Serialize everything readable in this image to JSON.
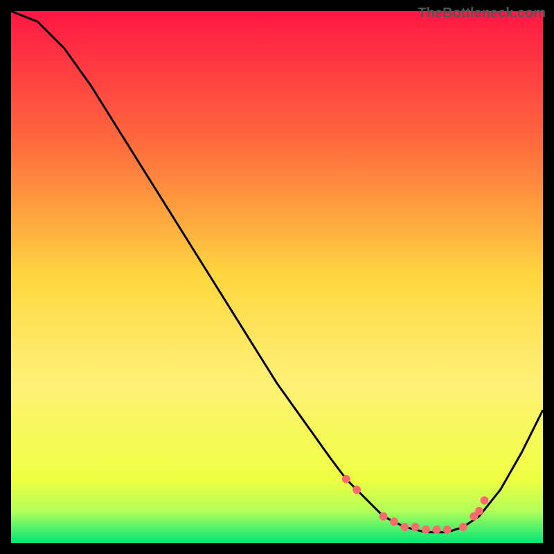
{
  "watermark": "TheBottleneck.com",
  "chart_data": {
    "type": "line",
    "title": "",
    "xlabel": "",
    "ylabel": "",
    "xlim": [
      0,
      100
    ],
    "ylim": [
      0,
      100
    ],
    "gradient_stops": [
      {
        "offset": 0,
        "color": "#ff1744"
      },
      {
        "offset": 25,
        "color": "#ff6b3d"
      },
      {
        "offset": 50,
        "color": "#ffd740"
      },
      {
        "offset": 70,
        "color": "#fff176"
      },
      {
        "offset": 88,
        "color": "#eeff41"
      },
      {
        "offset": 94,
        "color": "#b2ff59"
      },
      {
        "offset": 100,
        "color": "#00e676"
      }
    ],
    "series": [
      {
        "name": "bottleneck-curve",
        "color": "#000000",
        "x": [
          0,
          5,
          10,
          15,
          20,
          25,
          30,
          35,
          40,
          45,
          50,
          55,
          60,
          63,
          66,
          70,
          74,
          78,
          82,
          85,
          88,
          92,
          96,
          100
        ],
        "y": [
          100,
          98,
          93,
          86,
          78,
          70,
          62,
          54,
          46,
          38,
          30,
          23,
          16,
          12,
          9,
          5,
          3,
          2,
          2,
          3,
          5,
          10,
          17,
          25
        ]
      }
    ],
    "markers": {
      "name": "highlight-points",
      "color": "#ff6b6b",
      "radius": 6,
      "points": [
        {
          "x": 63,
          "y": 12
        },
        {
          "x": 65,
          "y": 10
        },
        {
          "x": 70,
          "y": 5
        },
        {
          "x": 72,
          "y": 4
        },
        {
          "x": 74,
          "y": 3
        },
        {
          "x": 76,
          "y": 3
        },
        {
          "x": 78,
          "y": 2.5
        },
        {
          "x": 80,
          "y": 2.5
        },
        {
          "x": 82,
          "y": 2.5
        },
        {
          "x": 85,
          "y": 3
        },
        {
          "x": 87,
          "y": 5
        },
        {
          "x": 88,
          "y": 6
        },
        {
          "x": 89,
          "y": 8
        }
      ]
    }
  }
}
